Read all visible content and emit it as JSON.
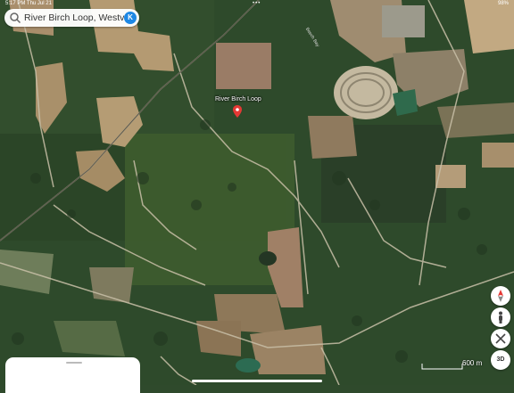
{
  "status_bar": {
    "time": "5:17 PM",
    "day": "Thu Jul 21",
    "dots": "•••",
    "battery": "98%"
  },
  "search": {
    "query": "River Birch Loop, Westvil",
    "avatar_letter": "K"
  },
  "map": {
    "pin_label": "River Birch Loop",
    "road_label": "Beech Bay",
    "scale_text": "600 m"
  },
  "controls": {
    "three_d_label": "3D"
  },
  "colors": {
    "pin": "#e53935",
    "search_avatar": "#1e88e5",
    "forest": "#2f4a2c",
    "field": "#b59c74"
  }
}
